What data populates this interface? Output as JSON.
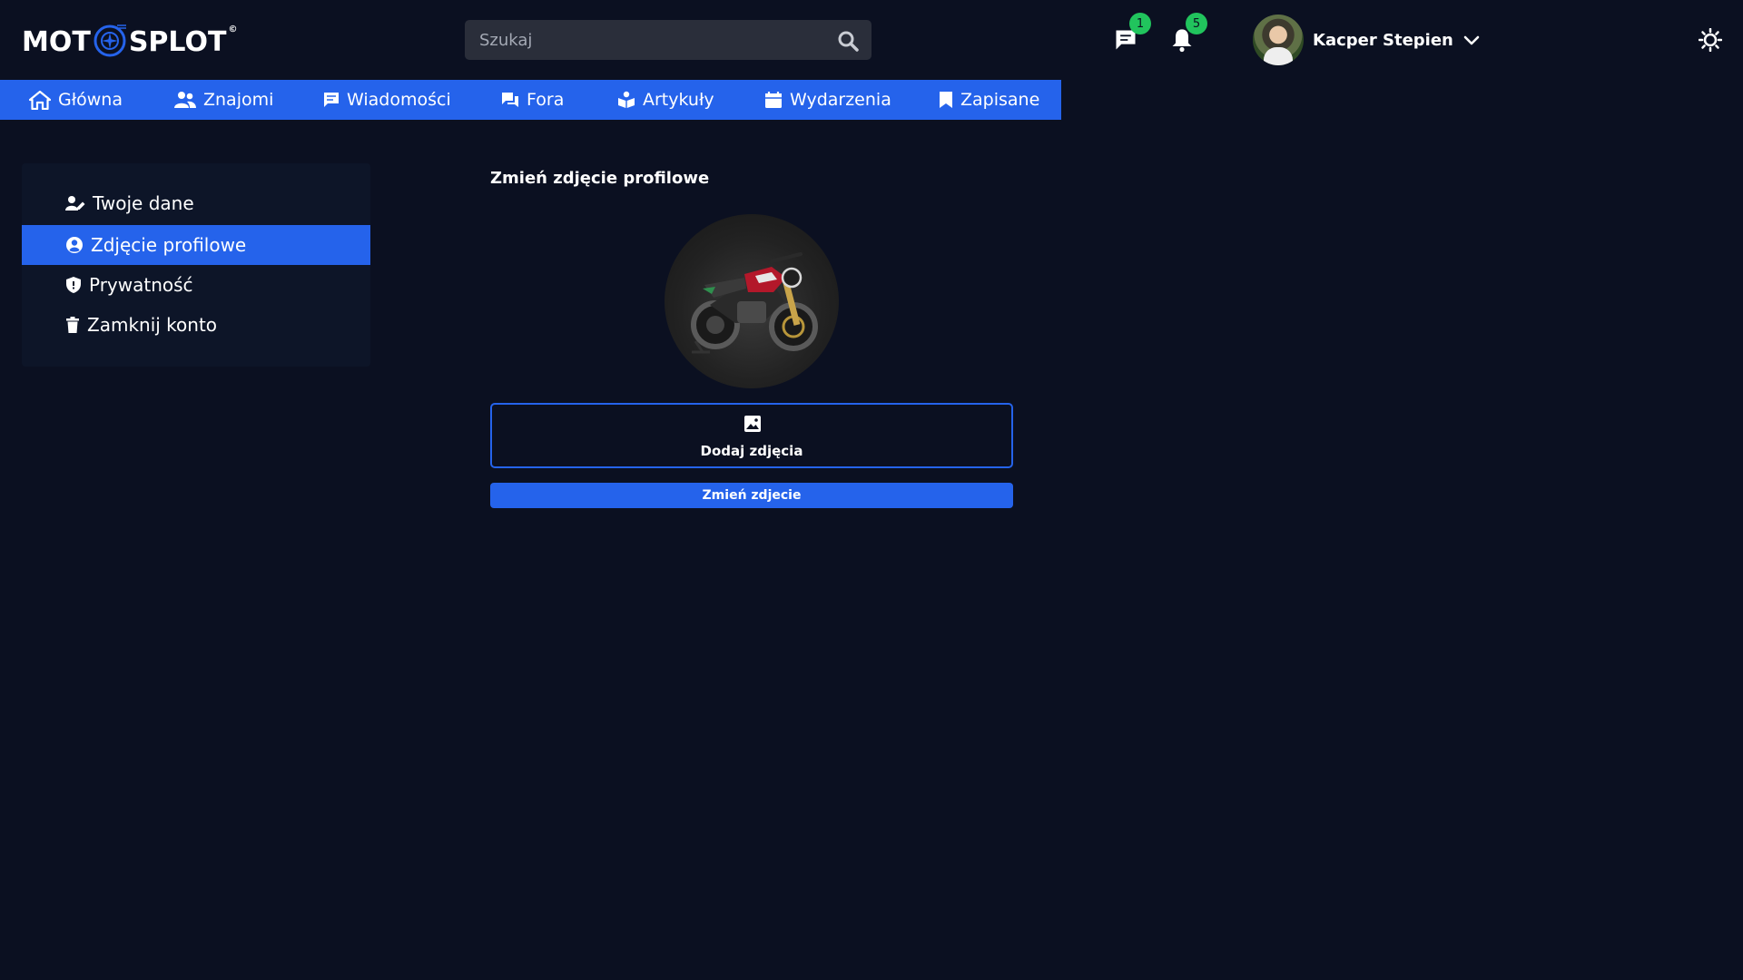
{
  "brand": {
    "logo_part1": "MOT",
    "logo_part2": "SPLOT",
    "logo_mark": "©",
    "accent_color": "#2563eb"
  },
  "search": {
    "placeholder": "Szukaj",
    "icon": "search-icon"
  },
  "header": {
    "messages": {
      "icon": "chat-icon",
      "badge": "1"
    },
    "notifications": {
      "icon": "bell-icon",
      "badge": "5"
    },
    "user": {
      "name": "Kacper Stepien",
      "icon": "chevron-down-icon"
    },
    "theme_toggle_icon": "sun-icon",
    "badge_color": "#21c45d"
  },
  "nav": {
    "items": [
      {
        "label": "Główna",
        "icon": "home-icon"
      },
      {
        "label": "Znajomi",
        "icon": "users-icon"
      },
      {
        "label": "Wiadomości",
        "icon": "message-icon"
      },
      {
        "label": "Fora",
        "icon": "forum-icon"
      },
      {
        "label": "Artykuły",
        "icon": "articles-icon"
      },
      {
        "label": "Wydarzenia",
        "icon": "calendar-icon"
      },
      {
        "label": "Zapisane",
        "icon": "bookmark-icon"
      }
    ]
  },
  "sidebar": {
    "items": [
      {
        "label": "Twoje dane",
        "icon": "user-edit-icon",
        "active": false
      },
      {
        "label": "Zdjęcie profilowe",
        "icon": "user-circle-icon",
        "active": true
      },
      {
        "label": "Prywatność",
        "icon": "shield-icon",
        "active": false
      },
      {
        "label": "Zamknij konto",
        "icon": "trash-icon",
        "active": false
      }
    ]
  },
  "main": {
    "title": "Zmień zdjęcie profilowe",
    "upload_label": "Dodaj zdjęcia",
    "upload_icon": "image-icon",
    "submit_label": "Zmień zdjecie"
  }
}
